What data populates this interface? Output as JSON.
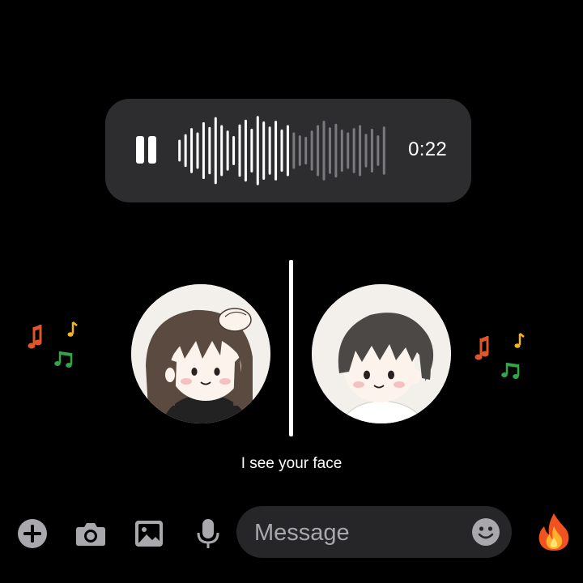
{
  "voice_message": {
    "duration": "0:22",
    "playback_state": "playing",
    "progress": 0.55,
    "waveform_heights": [
      0.3,
      0.45,
      0.62,
      0.5,
      0.78,
      0.65,
      0.92,
      0.7,
      0.55,
      0.4,
      0.72,
      0.85,
      0.6,
      0.95,
      0.8,
      0.66,
      0.82,
      0.58,
      0.7,
      0.5,
      0.42,
      0.38,
      0.55,
      0.7,
      0.82,
      0.64,
      0.74,
      0.58,
      0.5,
      0.62,
      0.7,
      0.46,
      0.6,
      0.42,
      0.66
    ],
    "played_color": "#ffffff",
    "unplayed_color": "#7a7a7e"
  },
  "caption": "I see your face",
  "composer": {
    "placeholder": "Message",
    "icons": [
      "plus-icon",
      "camera-icon",
      "gallery-icon",
      "microphone-icon",
      "emoji-icon",
      "fire-icon"
    ]
  },
  "colors": {
    "background": "#000000",
    "bubble": "#2d2d2f",
    "field": "#262628",
    "icon": "#a8a8ad"
  }
}
